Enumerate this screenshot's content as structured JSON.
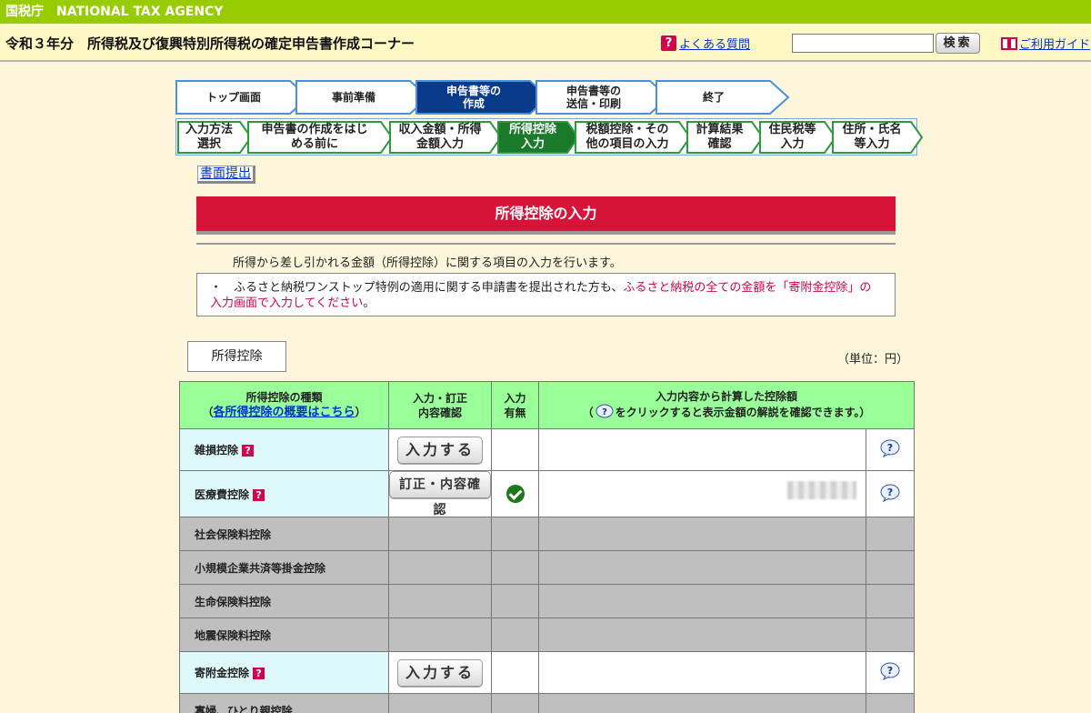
{
  "agency": {
    "name": "国税庁　NATIONAL TAX AGENCY"
  },
  "header": {
    "title": "令和３年分　所得税及び復興特別所得税の確定申告書作成コーナー",
    "faq_label": "よくある質問",
    "search_placeholder": "",
    "search_button": "検索",
    "guide_label": "ご利用ガイド"
  },
  "steps": [
    {
      "label": "トップ画面",
      "active": false
    },
    {
      "label": "事前準備",
      "active": false
    },
    {
      "label": "申告書等の\n作成",
      "active": true
    },
    {
      "label": "申告書等の\n送信・印刷",
      "active": false
    },
    {
      "label": "終了",
      "active": false
    }
  ],
  "substeps": [
    {
      "label": "入力方法\n選択",
      "active": false
    },
    {
      "label": "申告書の作成をはじ\nめる前に",
      "active": false
    },
    {
      "label": "収入金額・所得\n金額入力",
      "active": false
    },
    {
      "label": "所得控除\n入力",
      "active": true
    },
    {
      "label": "税額控除・その\n他の項目の入力",
      "active": false
    },
    {
      "label": "計算結果\n確認",
      "active": false
    },
    {
      "label": "住民税等\n入力",
      "active": false
    },
    {
      "label": "住所・氏名\n等入力",
      "active": false
    }
  ],
  "paper_submission": "書面提出",
  "page_title": "所得控除の入力",
  "intro": "所得から差し引かれる金額（所得控除）に関する項目の入力を行います。",
  "notice": {
    "bullet": "・　ふるさと納税ワンストップ特例の適用に関する申請書を提出された方も、",
    "highlight": "ふるさと納税の全ての金額を「寄附金控除」の入力画面で入力してください",
    "tail": "。"
  },
  "section_tab": "所得控除",
  "unit": "（単位：円）",
  "table": {
    "headers": {
      "type": "所得控除の種類",
      "type_link": "各所得控除の概要はこちら",
      "input": "入力・訂正\n内容確認",
      "has_input": "入力\n有無",
      "amount_line1": "入力内容から計算した控除額",
      "amount_line2": "をクリックすると表示金額の解説を確認できます。）"
    },
    "rows": [
      {
        "name": "雑損控除",
        "button": "入力する",
        "active": true,
        "has_help": true,
        "entered": false
      },
      {
        "name": "医療費控除",
        "button": "訂正・内容確認",
        "active": true,
        "has_help": true,
        "entered": true
      },
      {
        "name": "社会保険料控除",
        "active": false
      },
      {
        "name": "小規模企業共済等掛金控除",
        "active": false
      },
      {
        "name": "生命保険料控除",
        "active": false
      },
      {
        "name": "地震保険料控除",
        "active": false
      },
      {
        "name": "寄附金控除",
        "button": "入力する",
        "active": true,
        "has_help": true,
        "entered": false
      },
      {
        "name": "寡婦、ひとり親控除",
        "active": false
      }
    ]
  },
  "colors": {
    "agency_bar": "#99cc00",
    "heading": "#d7133a",
    "table_header": "#99ff99",
    "active_step": "#0a3a8a",
    "active_substep": "#1a7a2a"
  }
}
